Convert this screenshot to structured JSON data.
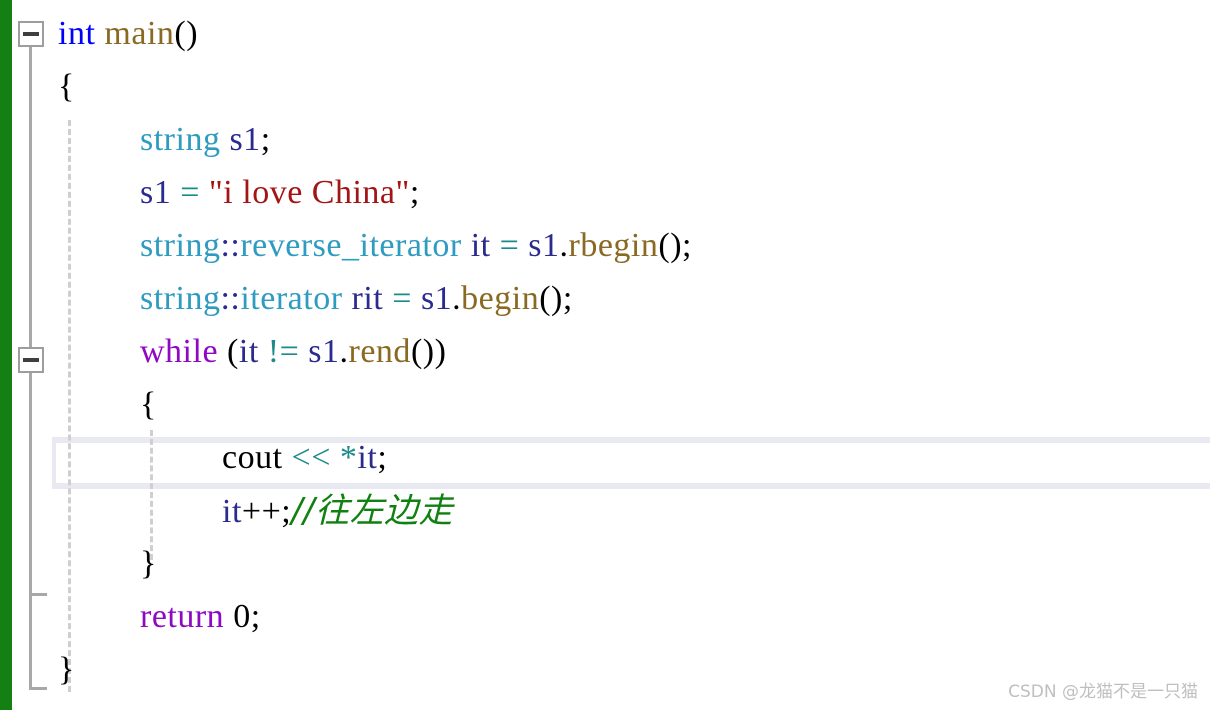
{
  "editor": {
    "title": "C++ code editor view",
    "background_color": "#ffffff",
    "change_bar_color": "#148014",
    "highlight_color": "#e9e9f2",
    "highlighted_line_index": 7
  },
  "colors": {
    "keyword": "#0000ff",
    "control": "#8f08c4",
    "type": "#2e9bc0",
    "variable": "#2b2b8f",
    "function": "#8a6a22",
    "string": "#a31515",
    "operator": "#1a8a8a",
    "comment": "#108010",
    "plain": "#000000",
    "guide": "#cfcfcf",
    "fold": "#a8a8a8"
  },
  "fold_markers": [
    {
      "name": "fold-toggle-main",
      "state": "expanded",
      "glyph": "minus"
    },
    {
      "name": "fold-toggle-while",
      "state": "expanded",
      "glyph": "minus"
    }
  ],
  "code": {
    "language": "C++",
    "lines": [
      {
        "indent": 0,
        "text": "int main()"
      },
      {
        "indent": 0,
        "text": "{"
      },
      {
        "indent": 1,
        "text": "string s1;"
      },
      {
        "indent": 1,
        "text": "s1 = \"i love China\";"
      },
      {
        "indent": 1,
        "text": "string::reverse_iterator it = s1.rbegin();"
      },
      {
        "indent": 1,
        "text": "string::iterator rit = s1.begin();"
      },
      {
        "indent": 1,
        "text": "while (it != s1.rend())"
      },
      {
        "indent": 1,
        "text": "{"
      },
      {
        "indent": 2,
        "text": "cout << *it;"
      },
      {
        "indent": 2,
        "text": "it++;//往左边走"
      },
      {
        "indent": 1,
        "text": "}"
      },
      {
        "indent": 1,
        "text": "return 0;"
      },
      {
        "indent": 0,
        "text": "}"
      }
    ],
    "tokens": {
      "line1": {
        "kw": "int",
        "fn": "main",
        "punct": "()"
      },
      "line2": {
        "brace": "{"
      },
      "line3": {
        "type": "string",
        "var": "s1",
        "punct": ";"
      },
      "line4": {
        "var": "s1",
        "op": "=",
        "str": "\"i love China\"",
        "punct": ";"
      },
      "line5": {
        "type1": "string",
        "sep": "::",
        "type2": "reverse_iterator",
        "var1": "it",
        "op": "=",
        "var2": "s1",
        "dot": ".",
        "fn": "rbegin",
        "punct": "();"
      },
      "line6": {
        "type1": "string",
        "sep": "::",
        "type2": "iterator",
        "var1": "rit",
        "op": "=",
        "var2": "s1",
        "dot": ".",
        "fn": "begin",
        "punct": "();"
      },
      "line7": {
        "ctl": "while",
        "open": "(",
        "var1": "it",
        "op": "!=",
        "var2": "s1",
        "dot": ".",
        "fn": "rend",
        "close": "())"
      },
      "line8": {
        "brace": "{"
      },
      "line9": {
        "plain": "cout",
        "op1": "<<",
        "op2": "*",
        "var": "it",
        "punct": ";"
      },
      "line10": {
        "var": "it",
        "inc": "++",
        "punct": ";",
        "comment": "//往左边走"
      },
      "line11": {
        "brace": "}"
      },
      "line12": {
        "ctl": "return",
        "num": "0",
        "punct": ";"
      },
      "line13": {
        "brace": "}"
      }
    }
  },
  "watermark": {
    "text": "CSDN @龙猫不是一只猫"
  }
}
